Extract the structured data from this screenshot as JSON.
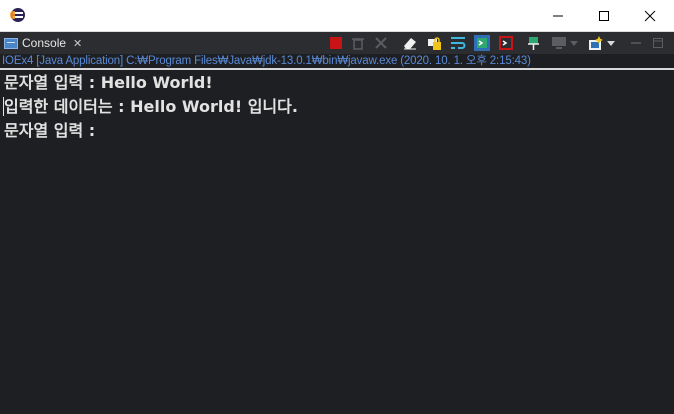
{
  "window": {
    "minimize_icon": "minimize-icon",
    "maximize_icon": "maximize-icon",
    "close_icon": "close-icon"
  },
  "view": {
    "tab_label": "Console",
    "tab_icon": "console-icon",
    "tab_close_icon": "close-tab-icon"
  },
  "status_line": "IOEx4 [Java Application] C:₩Program Files₩Java₩jdk-13.0.1₩bin₩javaw.exe (2020. 10. 1. 오후 2:15:43)",
  "console": {
    "lines": [
      "문자열 입력 : Hello World!",
      "입력한 데이터는 : Hello World! 입니다.",
      "문자열 입력 :"
    ]
  },
  "colors": {
    "terminate": "#c81414",
    "accent_green": "#2fa870",
    "link_blue": "#5a8ad6"
  }
}
